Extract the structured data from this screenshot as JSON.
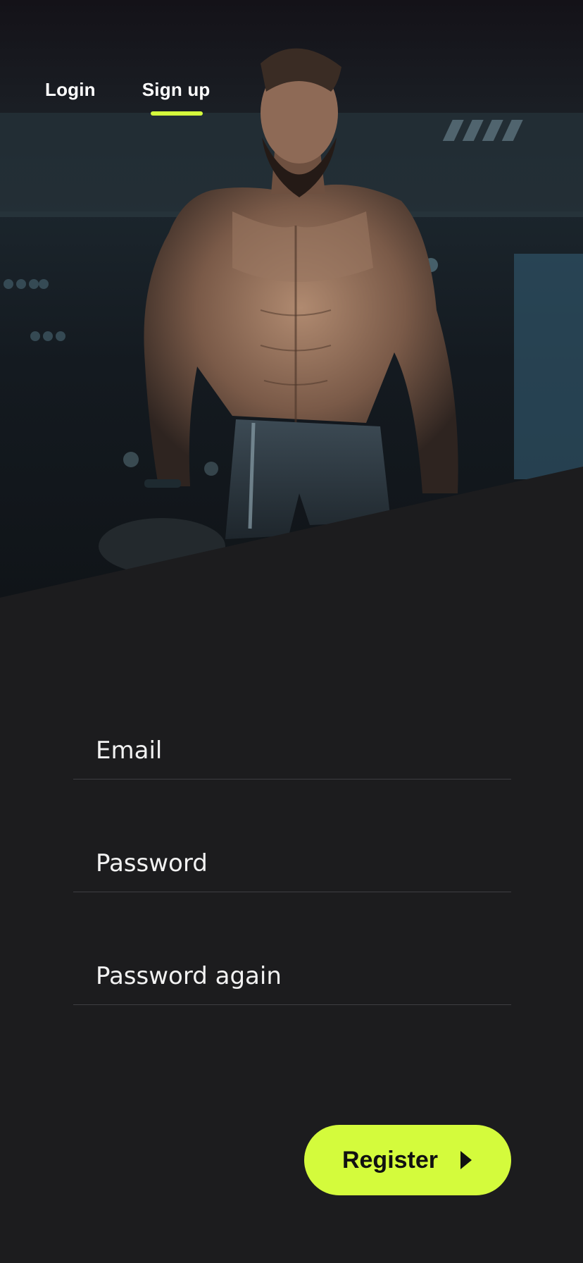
{
  "tabs": [
    {
      "label": "Login",
      "active": false
    },
    {
      "label": "Sign up",
      "active": true
    }
  ],
  "form": {
    "email_placeholder": "Email",
    "password_placeholder": "Password",
    "password_again_placeholder": "Password again"
  },
  "register_button": {
    "label": "Register",
    "icon": "chevron-right-icon"
  },
  "colors": {
    "accent": "#d4fb3c",
    "background": "#1c1c1e",
    "text": "#ffffff"
  },
  "hero": {
    "image": "muscular-man-gym-photo"
  }
}
